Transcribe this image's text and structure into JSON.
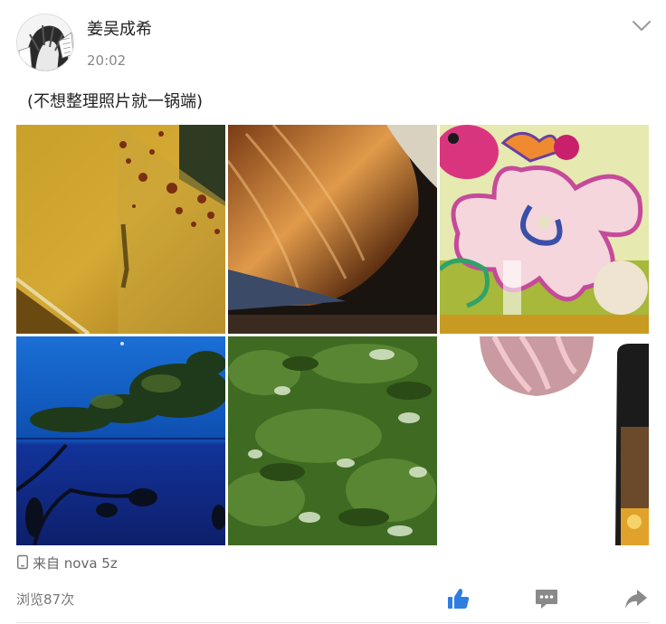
{
  "post": {
    "author": "姜吴成希",
    "time": "20:02",
    "text": "(不想整理照片就一锅端)",
    "photos": [
      {
        "name": "photo-rusty-wall"
      },
      {
        "name": "photo-hair-closeup"
      },
      {
        "name": "photo-cartoon-flower-drawing"
      },
      {
        "name": "photo-tree-blue-sky"
      },
      {
        "name": "photo-green-leaves"
      },
      {
        "name": "photo-avatar-and-phone"
      }
    ],
    "device_label": "来自 nova 5z",
    "views_label": "浏览87次"
  },
  "colors": {
    "like_blue": "#2f7de1",
    "icon_gray": "#8a8a8a",
    "text_gray": "#888888"
  },
  "icons": {
    "menu": "chevron-down-icon",
    "device": "phone-icon",
    "like": "thumbs-up-icon",
    "comment": "comment-icon",
    "share": "share-arrow-icon"
  }
}
